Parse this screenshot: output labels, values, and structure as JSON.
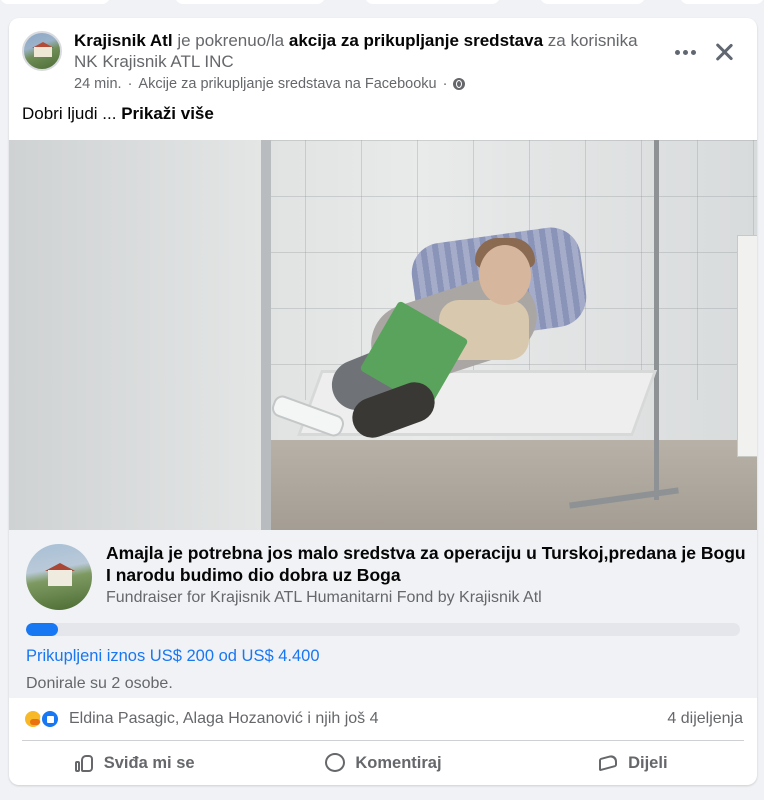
{
  "post": {
    "author": "Krajisnik Atl",
    "verb": "je pokrenuo/la",
    "action": "akcija za prikupljanje sredstava",
    "for_prefix": "za korisnika",
    "beneficiary": "NK Krajisnik ATL INC",
    "time": "24 min.",
    "separator": "·",
    "source": "Akcije za prikupljanje sredstava na Facebooku",
    "text": "Dobri ljudi ...",
    "see_more": "Prikaži više"
  },
  "fundraiser": {
    "title": "Amajla je potrebna jos malo sredstva za operaciju u Turskoj,predana je Bogu I narodu budimo dio dobra uz Boga",
    "subtitle": "Fundraiser for Krajisnik ATL Humanitarni Fond by Krajisnik Atl",
    "raised_text": "Prikupljeni iznos US$ 200 od US$ 4.400",
    "raised_fraction": 0.045,
    "donors_text": "Donirale su 2 osobe."
  },
  "engagement": {
    "reaction_names": "Eldina Pasagic, Alaga Hozanović i njih još 4",
    "shares": "4 dijeljenja"
  },
  "actions": {
    "like": "Sviđa mi se",
    "comment": "Komentiraj",
    "share": "Dijeli"
  },
  "colors": {
    "accent": "#1877f2",
    "muted": "#65676b",
    "background": "#f0f2f5"
  },
  "icons": [
    "more-options-icon",
    "close-icon",
    "globe-icon",
    "care-reaction-icon",
    "like-reaction-icon",
    "like-icon",
    "comment-icon",
    "share-icon"
  ]
}
